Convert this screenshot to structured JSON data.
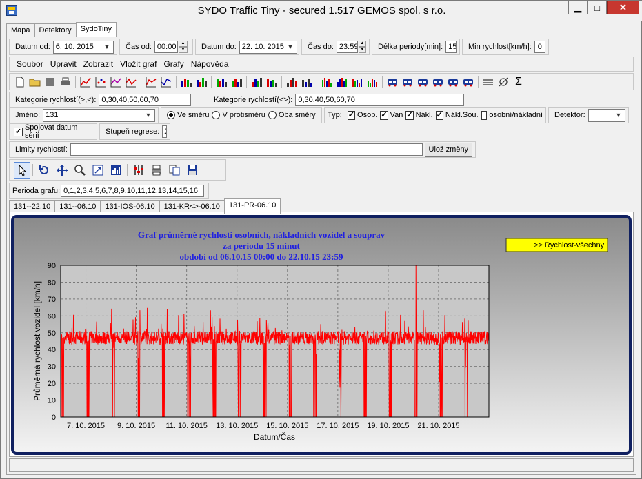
{
  "window": {
    "title": "SYDO Traffic Tiny - secured 1.517 GEMOS spol. s r.o.",
    "controls": {
      "minimize": "▁",
      "maximize": "□",
      "close": "✕"
    }
  },
  "main_tabs": [
    "Mapa",
    "Detektory",
    "SydoTiny"
  ],
  "filter": {
    "datum_od_label": "Datum od:",
    "datum_od_value": "6. 10. 2015",
    "cas_od_label": "Čas od:",
    "cas_od_value": "00:00",
    "datum_do_label": "Datum do:",
    "datum_do_value": "22. 10. 2015",
    "cas_do_label": "Čas do:",
    "cas_do_value": "23:59",
    "perioda_label": "Délka periody[min]:",
    "perioda_value": "15",
    "min_rychlost_label": "Min rychlost[km/h]:",
    "min_rychlost_value": "0"
  },
  "menu": [
    "Soubor",
    "Upravit",
    "Zobrazit",
    "Vložit graf",
    "Grafy",
    "Nápověda"
  ],
  "categories": {
    "kat1_label": "Kategorie rychlostí(>,<):",
    "kat1_value": "0,30,40,50,60,70",
    "kat2_label": "Kategorie rychlostí(<>):",
    "kat2_value": "0,30,40,50,60,70"
  },
  "selection": {
    "jmeno_label": "Jméno:",
    "jmeno_value": "131",
    "ve_smeru": "Ve směru",
    "v_protismeru": "V protisměru",
    "oba_smery": "Oba směry",
    "typ_label": "Typ:",
    "osob": "Osob.",
    "van": "Van",
    "nakl": "Nákl.",
    "nakl_sou": "Nákl.Sou.",
    "osobni_nakladni": "osobní/nákladní",
    "detektor_label": "Detektor:",
    "detektor_value": ""
  },
  "options": {
    "spojovat_label": "Spojovat datum sérií",
    "stupen_label": "Stupeň regrese:",
    "stupen_value": "2"
  },
  "limits": {
    "label": "Limity rychlostí:",
    "value": "",
    "save_button": "Ulož změny"
  },
  "perioda_grafu": {
    "label": "Perioda grafu:",
    "value": "0,1,2,3,4,5,6,7,8,9,10,11,12,13,14,15,16"
  },
  "chart_tabs": [
    "131--22.10",
    "131--06.10",
    "131-IOS-06.10",
    "131-KR<>-06.10",
    "131-PR-06.10"
  ],
  "chart_data": {
    "type": "line",
    "title": "Graf průměrné rychlosti osobních, nákladních vozidel a souprav",
    "subtitle1": "za periodu 15 minut",
    "subtitle2": "období od 06.10.15 00:00 do 22.10.15 23:59",
    "xlabel": "Datum/Čas",
    "ylabel": "Průměrná rychlost vozidel [km/h]",
    "ylim": [
      0,
      90
    ],
    "yticks": [
      0,
      10,
      20,
      30,
      40,
      50,
      60,
      70,
      80,
      90
    ],
    "xlim": [
      "2015-10-06 00:00",
      "2015-10-22 23:59"
    ],
    "xtick_labels": [
      "7. 10. 2015",
      "9. 10. 2015",
      "11. 10. 2015",
      "13. 10. 2015",
      "15. 10. 2015",
      "17. 10. 2015",
      "19. 10. 2015",
      "21. 10. 2015"
    ],
    "grid": true,
    "legend": {
      "placement": "top-right",
      "entries": [
        ">> Rychlost-všechny"
      ]
    },
    "series": [
      {
        "name": ">> Rychlost-všechny",
        "color": "#ff0000",
        "period_minutes": 15,
        "typical_value": 47,
        "typical_range": [
          40,
          55
        ],
        "night_drops_to": 0,
        "peak": {
          "time": "2015-10-20 02:30",
          "value": 90
        }
      }
    ]
  },
  "colors": {
    "chart_series": "#ff0000",
    "chart_title": "#2020e0",
    "chart_frame": "#102060",
    "legend_line": "#ffff00"
  }
}
